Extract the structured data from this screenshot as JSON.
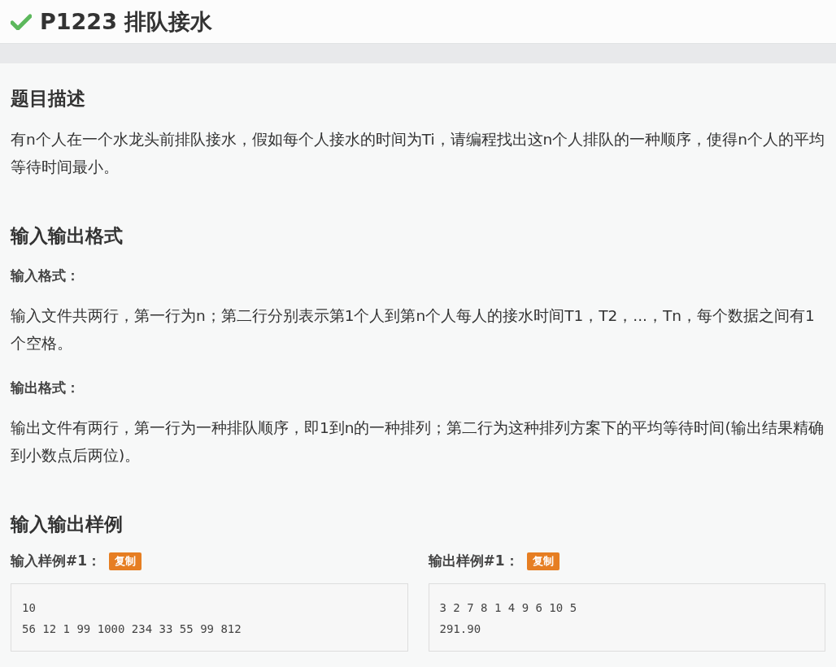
{
  "header": {
    "solved": true,
    "title": "P1223 排队接水"
  },
  "sections": [
    {
      "heading": "题目描述",
      "blocks": [
        {
          "kind": "paragraph",
          "text": "有n个人在一个水龙头前排队接水，假如每个人接水的时间为Ti，请编程找出这n个人排队的一种顺序，使得n个人的平均等待时间最小。"
        }
      ]
    },
    {
      "heading": "输入输出格式",
      "blocks": [
        {
          "kind": "subheading",
          "text": "输入格式："
        },
        {
          "kind": "paragraph",
          "text": "输入文件共两行，第一行为n；第二行分别表示第1个人到第n个人每人的接水时间T1，T2，...，Tn，每个数据之间有1个空格。"
        },
        {
          "kind": "subheading",
          "text": "输出格式："
        },
        {
          "kind": "paragraph",
          "text": "输出文件有两行，第一行为一种排队顺序，即1到n的一种排列；第二行为这种排列方案下的平均等待时间(输出结果精确到小数点后两位)。"
        }
      ]
    },
    {
      "heading": "输入输出样例",
      "samples": [
        {
          "label": "输入样例#1：",
          "copy": "复制",
          "lines": [
            "10",
            "56 12 1 99 1000 234 33 55 99 812"
          ]
        },
        {
          "label": "输出样例#1：",
          "copy": "复制",
          "lines": [
            "3 2 7 8 1 4 9 6 10 5",
            "291.90"
          ]
        }
      ]
    }
  ]
}
